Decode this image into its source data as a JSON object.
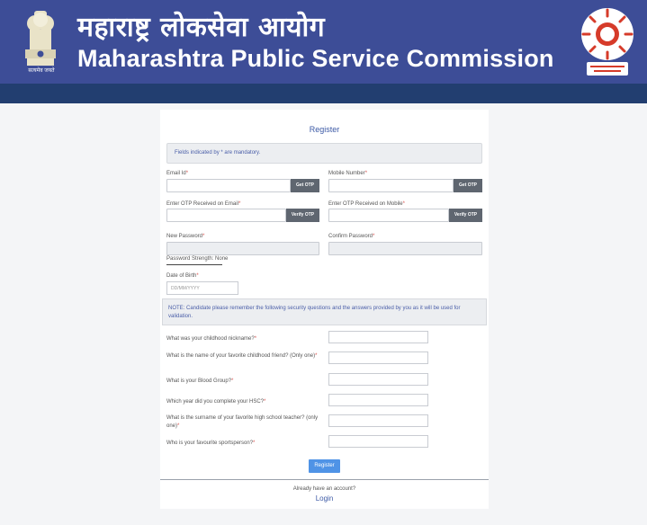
{
  "header": {
    "title_hindi": "महाराष्ट्र लोकसेवा आयोग",
    "title_english": "Maharashtra Public Service Commission",
    "emblem_caption": "सत्यमेव जयते",
    "emblem_icon": "ashoka-emblem-icon",
    "seal_icon": "mpsc-seal-icon",
    "colors": {
      "header_bg": "#3d4d97",
      "strip_bg": "#223e70",
      "seal_red": "#d63b2a"
    }
  },
  "form": {
    "title": "Register",
    "mandatory_note": "Fields indicated by * are mandatory.",
    "email_label": "Email Id",
    "email_otp_button": "Get OTP",
    "mobile_label": "Mobile Number",
    "mobile_otp_button": "Get OTP",
    "email_otp_label": "Enter OTP Received on Email",
    "email_verify_button": "Verify OTP",
    "mobile_otp_label": "Enter OTP Received on Mobile",
    "mobile_verify_button": "Verify OTP",
    "new_password_label": "New Password",
    "confirm_password_label": "Confirm Password",
    "password_strength": "Password Strength: None",
    "dob_label": "Date of Birth",
    "dob_placeholder": "DD/MM/YYYY",
    "security_note": "NOTE: Candidate please remember the following security questions and the answers provided by you as it will be used for validation.",
    "required_mark": "*",
    "questions": [
      "What was your childhood nickname?",
      "What is the name of your favorite childhood friend? (Only one)",
      "What is your Blood Group?",
      "Which year did you complete your HSC?",
      "What is the surname of your favorite high school teacher? (only one)",
      "Who is your favourite sportsperson?"
    ],
    "register_button": "Register",
    "account_prompt": "Already have an account?",
    "login_link": "Login"
  }
}
